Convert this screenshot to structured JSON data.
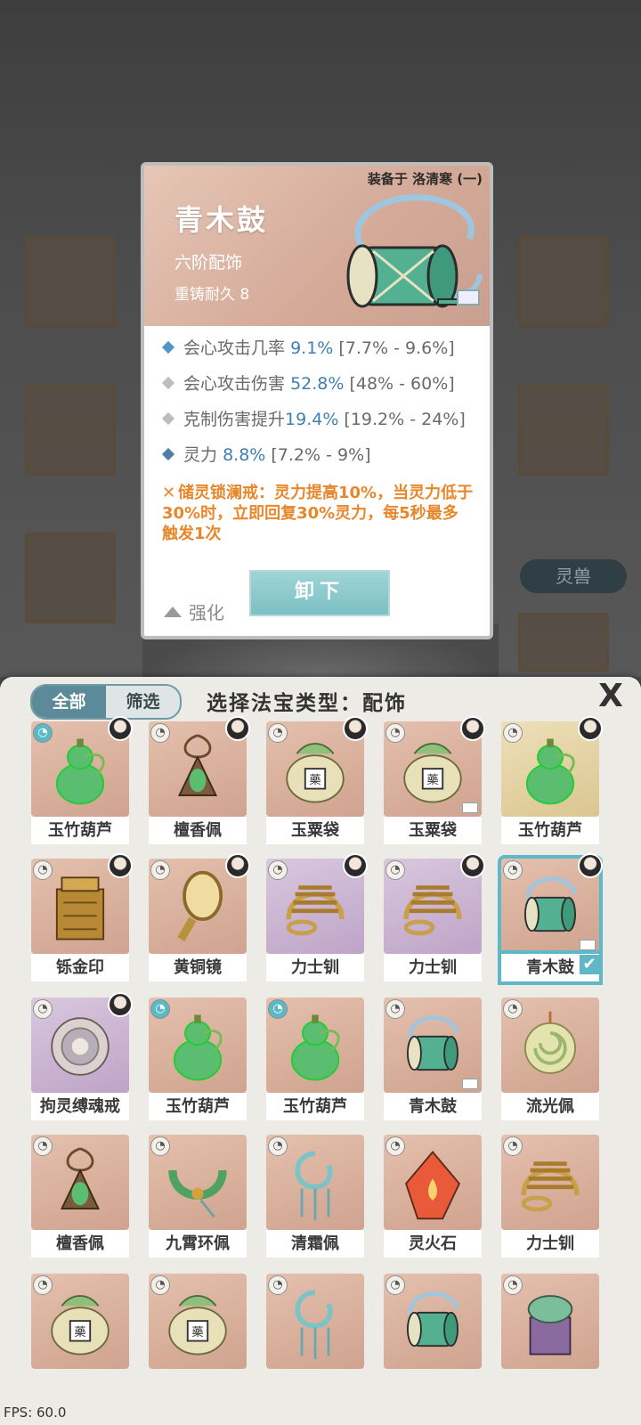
{
  "popup": {
    "equipped_text": "装备于 洛清寒 (一)",
    "name": "青木鼓",
    "tier": "六阶配饰",
    "durability": "重铸耐久 8",
    "stats": [
      {
        "name": "会心攻击几率",
        "value": "9.1%",
        "range": "[7.7% - 9.6%]",
        "color": "#4f95c8"
      },
      {
        "name": "会心攻击伤害",
        "value": "52.8%",
        "range": "[48% - 60%]",
        "color": "#bdbdbd"
      },
      {
        "name": "克制伤害提升",
        "value": "19.4%",
        "range": "[19.2% - 24%]",
        "color": "#bdbdbd"
      },
      {
        "name": "灵力",
        "value": "8.8%",
        "range": "[7.2% - 9%]",
        "color": "#4f7fa8"
      }
    ],
    "effect_text": "储灵锁澜戒：灵力提高10%，当灵力低于30%时，立即回复30%灵力，每5秒最多触发1次",
    "enhance_label": "强化",
    "unequip_label": "卸下"
  },
  "background": {
    "pill_label": "灵兽"
  },
  "panel": {
    "tabs": [
      "全部",
      "筛选"
    ],
    "title": "选择法宝类型：配饰",
    "close_label": "X"
  },
  "items": [
    {
      "name": "玉竹葫芦",
      "bg": "salmon",
      "spirit_blue": true,
      "avatar": true,
      "icon": "gourd"
    },
    {
      "name": "檀香佩",
      "bg": "salmon",
      "avatar": true,
      "icon": "pendant"
    },
    {
      "name": "玉粟袋",
      "bg": "salmon",
      "avatar": true,
      "icon": "bag"
    },
    {
      "name": "玉粟袋",
      "bg": "salmon",
      "avatar": true,
      "chest": true,
      "icon": "bag"
    },
    {
      "name": "玉竹葫芦",
      "bg": "gold",
      "avatar": true,
      "icon": "gourd"
    },
    {
      "name": "铄金印",
      "bg": "salmon",
      "avatar": true,
      "icon": "seal"
    },
    {
      "name": "黄铜镜",
      "bg": "salmon",
      "avatar": true,
      "icon": "mirror"
    },
    {
      "name": "力士钏",
      "bg": "purple",
      "avatar": true,
      "icon": "bracelet"
    },
    {
      "name": "力士钏",
      "bg": "purple",
      "avatar": true,
      "icon": "bracelet"
    },
    {
      "name": "青木鼓",
      "bg": "salmon",
      "avatar": true,
      "chest": true,
      "selected": true,
      "icon": "drum"
    },
    {
      "name": "拘灵缚魂戒",
      "bg": "purple",
      "avatar": true,
      "icon": "ring"
    },
    {
      "name": "玉竹葫芦",
      "bg": "salmon",
      "spirit_blue": true,
      "icon": "gourd"
    },
    {
      "name": "玉竹葫芦",
      "bg": "salmon",
      "spirit_blue": true,
      "icon": "gourd"
    },
    {
      "name": "青木鼓",
      "bg": "salmon",
      "chest": true,
      "icon": "drum"
    },
    {
      "name": "流光佩",
      "bg": "salmon",
      "icon": "jade"
    },
    {
      "name": "檀香佩",
      "bg": "salmon",
      "icon": "pendant"
    },
    {
      "name": "九霄环佩",
      "bg": "salmon",
      "icon": "ringpendant"
    },
    {
      "name": "清霜佩",
      "bg": "salmon",
      "icon": "frost"
    },
    {
      "name": "灵火石",
      "bg": "salmon",
      "icon": "firestone"
    },
    {
      "name": "力士钏",
      "bg": "salmon",
      "icon": "bracelet"
    },
    {
      "name": "",
      "bg": "salmon",
      "icon": "bag"
    },
    {
      "name": "",
      "bg": "salmon",
      "icon": "bag"
    },
    {
      "name": "",
      "bg": "salmon",
      "icon": "frost"
    },
    {
      "name": "",
      "bg": "salmon",
      "icon": "drum"
    },
    {
      "name": "",
      "bg": "salmon",
      "icon": "incense"
    }
  ],
  "fps": "FPS: 60.0"
}
